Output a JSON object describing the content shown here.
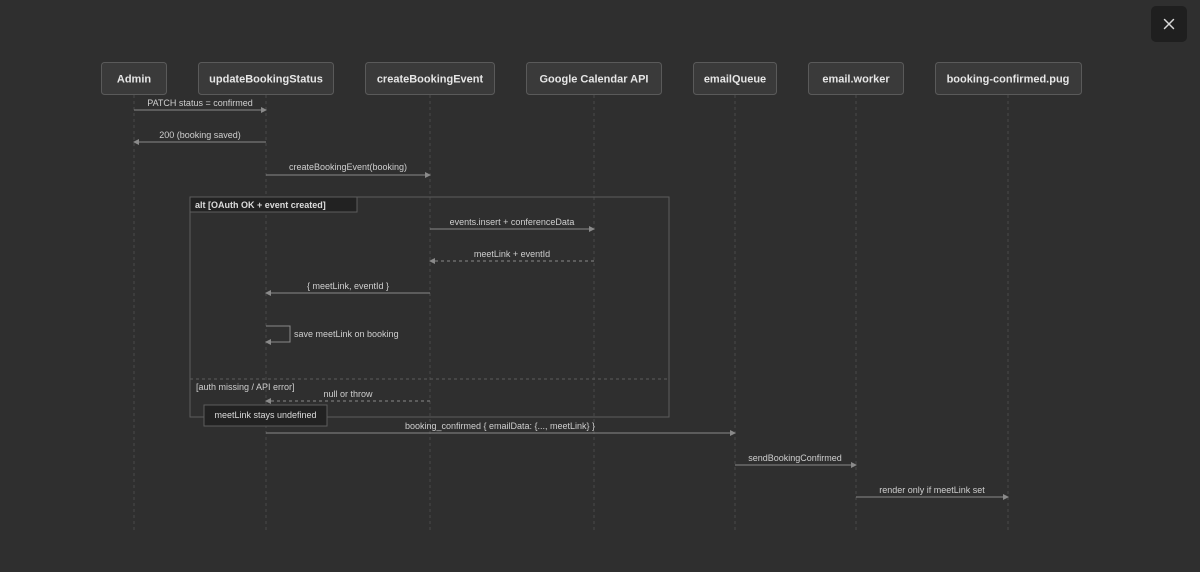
{
  "colors": {
    "background": "#2f2f2f",
    "actor_fill": "#3a3a3a",
    "actor_stroke": "#5a5a5a",
    "actor_text": "#e6e6e6",
    "lifeline": "#4a4a4a",
    "message": "#8a8a8a",
    "message_text": "#cfcfcf",
    "frame": "#5c5c5c",
    "note_fill": "#222222"
  },
  "close_button": {
    "icon": "close-icon",
    "glyph": "✕"
  },
  "actors": [
    {
      "id": "admin",
      "label": "Admin"
    },
    {
      "id": "ubs",
      "label": "updateBookingStatus"
    },
    {
      "id": "cbe",
      "label": "createBookingEvent"
    },
    {
      "id": "gcal",
      "label": "Google Calendar API"
    },
    {
      "id": "eq",
      "label": "emailQueue"
    },
    {
      "id": "ew",
      "label": "email.worker"
    },
    {
      "id": "tpl",
      "label": "booking-confirmed.pug"
    }
  ],
  "messages": [
    {
      "from": "admin",
      "to": "ubs",
      "label": "PATCH status = confirmed",
      "style": "solid"
    },
    {
      "from": "ubs",
      "to": "admin",
      "label": "200 (booking saved)",
      "style": "solid"
    },
    {
      "from": "ubs",
      "to": "cbe",
      "label": "createBookingEvent(booking)",
      "style": "solid"
    },
    {
      "from": "cbe",
      "to": "gcal",
      "label": "events.insert + conferenceData",
      "style": "solid"
    },
    {
      "from": "gcal",
      "to": "cbe",
      "label": "meetLink + eventId",
      "style": "dashed"
    },
    {
      "from": "cbe",
      "to": "ubs",
      "label": "{ meetLink, eventId }",
      "style": "solid"
    },
    {
      "from": "ubs",
      "to": "ubs",
      "label": "save meetLink on booking",
      "style": "self"
    },
    {
      "from": "cbe",
      "to": "ubs",
      "label": "null or throw",
      "style": "dashed"
    },
    {
      "from": "ubs",
      "to": "eq",
      "label": "booking_confirmed { emailData: {..., meetLink} }",
      "style": "solid"
    },
    {
      "from": "eq",
      "to": "ew",
      "label": "sendBookingConfirmed",
      "style": "solid"
    },
    {
      "from": "ew",
      "to": "tpl",
      "label": "render only if meetLink set",
      "style": "solid"
    }
  ],
  "alt_frame": {
    "label": "alt [OAuth OK + event created]",
    "else_label": "[auth missing / API error]"
  },
  "note": {
    "over": "ubs",
    "text": "meetLink stays undefined"
  }
}
